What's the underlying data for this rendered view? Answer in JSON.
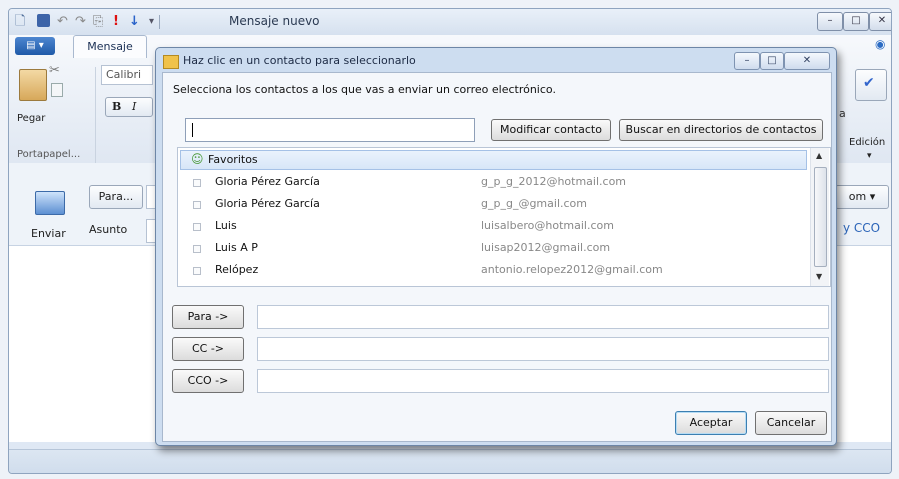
{
  "window": {
    "title": "Mensaje nuevo",
    "qat_icons": [
      "new-icon",
      "save-icon",
      "undo-icon",
      "redo-icon",
      "attach-icon",
      "priority-high-icon",
      "priority-low-icon",
      "customize-icon"
    ]
  },
  "ribbon": {
    "file_tab_label": "▤ ▾",
    "tab_label": "Mensaje",
    "paste_label": "Pegar",
    "clipboard_group": "Portapapel...",
    "font_name": "Calibri",
    "bold": "B",
    "italic": "I",
    "edit_label_prefix": "a",
    "edit_label": "Edición",
    "edit_chevron": "▾",
    "help_glyph": "◉",
    "spell_glyph": "઼"
  },
  "compose": {
    "send_label": "Enviar",
    "to_button": "Para...",
    "subject_label": "Asunto",
    "from_suffix": "om ▾",
    "bcc_link": "y CCO"
  },
  "dialog": {
    "title": "Haz clic en un contacto para seleccionarlo",
    "instruction": "Selecciona los contactos a los que vas a enviar un correo electrónico.",
    "search_value": "",
    "modify_button": "Modificar contacto",
    "directories_button": "Buscar en directorios de contactos",
    "group_label": "Favoritos",
    "contacts": [
      {
        "name": "Gloria Pérez García",
        "email": "g_p_g_2012@hotmail.com"
      },
      {
        "name": "Gloria Pérez García",
        "email": "g_p_g_@gmail.com"
      },
      {
        "name": "Luis",
        "email": "luisalbero@hotmail.com"
      },
      {
        "name": "Luis A P",
        "email": "luisap2012@gmail.com"
      },
      {
        "name": "Relópez",
        "email": "antonio.relopez2012@gmail.com"
      }
    ],
    "to_button": "Para ->",
    "cc_button": "CC ->",
    "bcc_button": "CCO ->",
    "to_value": "",
    "cc_value": "",
    "bcc_value": "",
    "ok_button": "Aceptar",
    "cancel_button": "Cancelar"
  }
}
